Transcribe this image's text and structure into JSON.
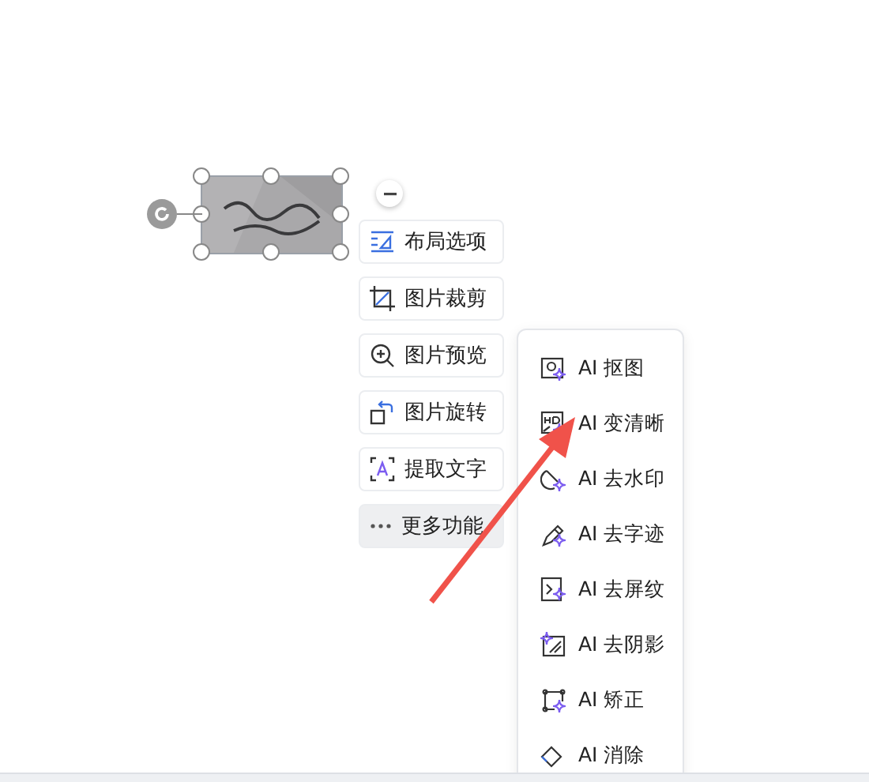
{
  "image": {
    "kind": "picture",
    "selected": true
  },
  "toolbar": [
    {
      "label": "布局选项",
      "selected": false
    },
    {
      "label": "图片裁剪",
      "selected": false
    },
    {
      "label": "图片预览",
      "selected": false
    },
    {
      "label": "图片旋转",
      "selected": false
    },
    {
      "label": "提取文字",
      "selected": false
    },
    {
      "label": "更多功能",
      "selected": true
    }
  ],
  "more_menu": [
    {
      "label": "AI 抠图"
    },
    {
      "label": "AI 变清晰"
    },
    {
      "label": "AI 去水印"
    },
    {
      "label": "AI 去字迹"
    },
    {
      "label": "AI 去屏纹"
    },
    {
      "label": "AI 去阴影"
    },
    {
      "label": "AI 矫正"
    },
    {
      "label": "AI 消除"
    }
  ]
}
